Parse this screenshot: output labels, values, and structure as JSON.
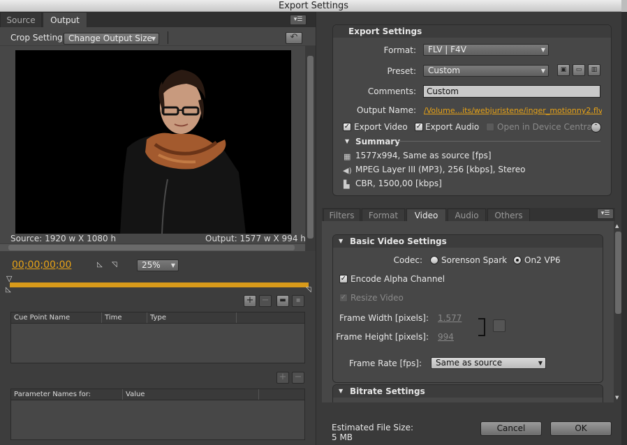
{
  "window": {
    "title": "Export Settings"
  },
  "left": {
    "tabs": [
      {
        "label": "Source"
      },
      {
        "label": "Output"
      }
    ],
    "crop_label": "Crop Setting",
    "crop_dropdown": "Change Output Size",
    "source_info": "Source: 1920 w X 1080 h",
    "output_info": "Output: 1577 w X 994 h",
    "timecode": "00;00;00;00",
    "zoom": "25%",
    "cue_table": {
      "columns": [
        "Cue Point Name",
        "Time",
        "Type"
      ]
    },
    "param_table": {
      "columns": [
        "Parameter Names for:",
        "Value"
      ]
    }
  },
  "export": {
    "section_title": "Export Settings",
    "format_label": "Format:",
    "format_value": "FLV | F4V",
    "preset_label": "Preset:",
    "preset_value": "Custom",
    "comments_label": "Comments:",
    "comments_value": "Custom",
    "output_name_label": "Output Name:",
    "output_name_value": "/Volume...its/webjuristene/inger_motionny2.flv",
    "export_video": "Export Video",
    "export_audio": "Export Audio",
    "open_device_central": "Open in Device Central",
    "summary_title": "Summary",
    "summary_lines": [
      "1577x994, Same as source [fps]",
      "MPEG Layer III (MP3), 256 [kbps], Stereo",
      "CBR, 1500,00 [kbps]"
    ]
  },
  "settings_tabs": [
    {
      "label": "Filters"
    },
    {
      "label": "Format"
    },
    {
      "label": "Video"
    },
    {
      "label": "Audio"
    },
    {
      "label": "Others"
    }
  ],
  "video": {
    "basic_title": "Basic Video Settings",
    "codec_label": "Codec:",
    "codec_opt1": "Sorenson Spark",
    "codec_opt2": "On2 VP6",
    "encode_alpha": "Encode Alpha Channel",
    "resize_video": "Resize Video",
    "frame_width_label": "Frame Width [pixels]:",
    "frame_width_value": "1.577",
    "frame_height_label": "Frame Height [pixels]:",
    "frame_height_value": "994",
    "frame_rate_label": "Frame Rate [fps]:",
    "frame_rate_value": "Same as source",
    "bitrate_title": "Bitrate Settings"
  },
  "footer": {
    "est_label": "Estimated File Size:",
    "est_value": "5 MB",
    "cancel": "Cancel",
    "ok": "OK"
  },
  "colors": {
    "accent": "#e8a316",
    "panel": "#474747"
  }
}
